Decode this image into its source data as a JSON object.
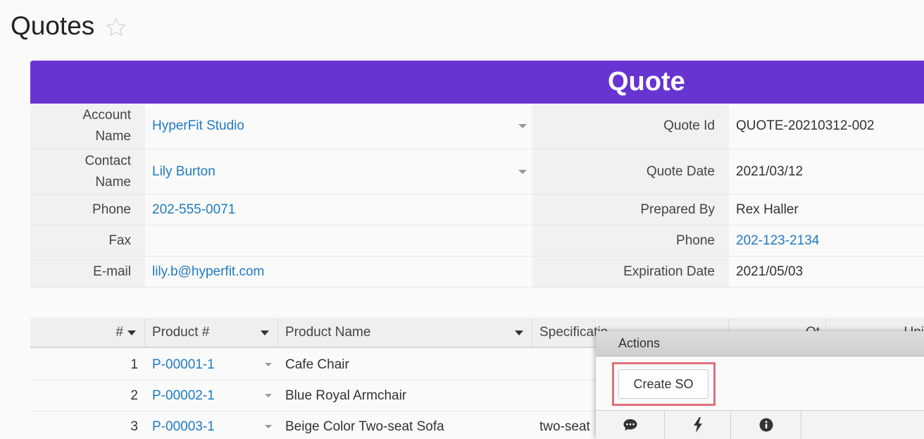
{
  "page": {
    "title": "Quotes"
  },
  "banner": {
    "title": "Quote"
  },
  "form": {
    "left": [
      {
        "label": "Account Name",
        "value": "HyperFit Studio"
      },
      {
        "label": "Contact Name",
        "value": "Lily Burton"
      },
      {
        "label": "Phone",
        "value": "202-555-0071"
      },
      {
        "label": "Fax",
        "value": ""
      },
      {
        "label": "E-mail",
        "value": "lily.b@hyperfit.com"
      }
    ],
    "right": [
      {
        "label": "Quote Id",
        "value": "QUOTE-20210312-002"
      },
      {
        "label": "Quote Date",
        "value": "2021/03/12"
      },
      {
        "label": "Prepared By",
        "value": "Rex Haller"
      },
      {
        "label": "Phone",
        "value": "202-123-2134"
      },
      {
        "label": "Expiration Date",
        "value": "2021/05/03"
      }
    ]
  },
  "grid": {
    "headers": {
      "num": "#",
      "product_no": "Product #",
      "product_name": "Product Name",
      "spec": "Specificatio",
      "qty": "Qt",
      "unit": "Uni"
    },
    "rows": [
      {
        "num": "1",
        "product_no": "P-00001-1",
        "product_name": "Cafe Chair",
        "spec": ""
      },
      {
        "num": "2",
        "product_no": "P-00002-1",
        "product_name": "Blue Royal Armchair",
        "spec": ""
      },
      {
        "num": "3",
        "product_no": "P-00003-1",
        "product_name": "Beige Color Two-seat Sofa",
        "spec": "two-seat"
      }
    ]
  },
  "actions": {
    "header": "Actions",
    "create_so": "Create SO"
  },
  "icons": [
    "star-outline-icon",
    "caret-down-icon",
    "comment-icon",
    "lightning-icon",
    "info-icon"
  ],
  "colors": {
    "banner": "#6834d1",
    "link": "#1f7ac2",
    "highlight": "#e0707b"
  }
}
